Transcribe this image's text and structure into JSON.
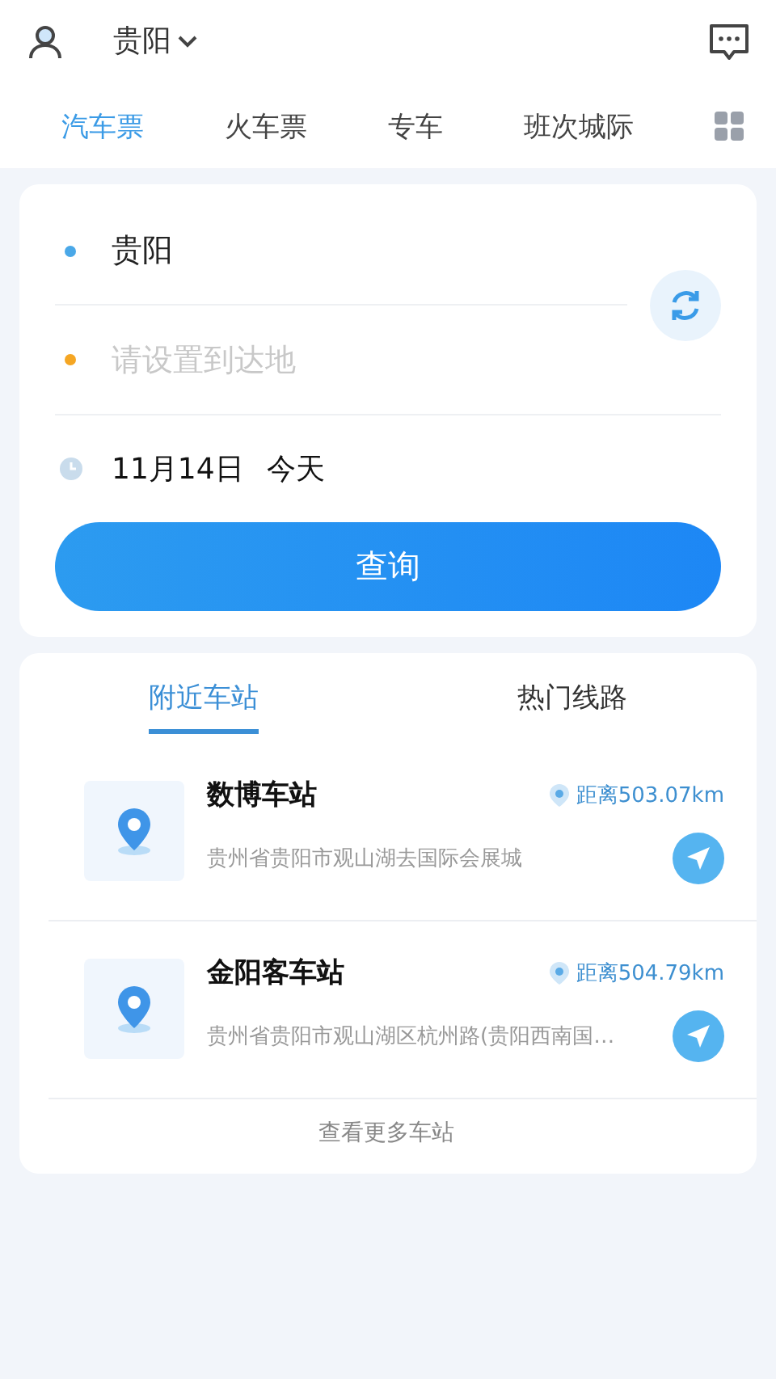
{
  "header": {
    "city": "贵阳"
  },
  "tabs": [
    {
      "label": "汽车票",
      "selected": true
    },
    {
      "label": "火车票",
      "selected": false
    },
    {
      "label": "专车",
      "selected": false
    },
    {
      "label": "班次城际",
      "selected": false
    }
  ],
  "search": {
    "from": "贵阳",
    "to_placeholder": "请设置到达地",
    "date": "11月14日",
    "day": "今天",
    "button": "查询"
  },
  "station_tabs": [
    {
      "label": "附近车站",
      "selected": true
    },
    {
      "label": "热门线路",
      "selected": false
    }
  ],
  "stations": [
    {
      "name": "数博车站",
      "distance": "距离503.07km",
      "address": "贵州省贵阳市观山湖去国际会展城"
    },
    {
      "name": "金阳客车站",
      "distance": "距离504.79km",
      "address": "贵州省贵阳市观山湖区杭州路(贵阳西南国…"
    }
  ],
  "more": "查看更多车站"
}
